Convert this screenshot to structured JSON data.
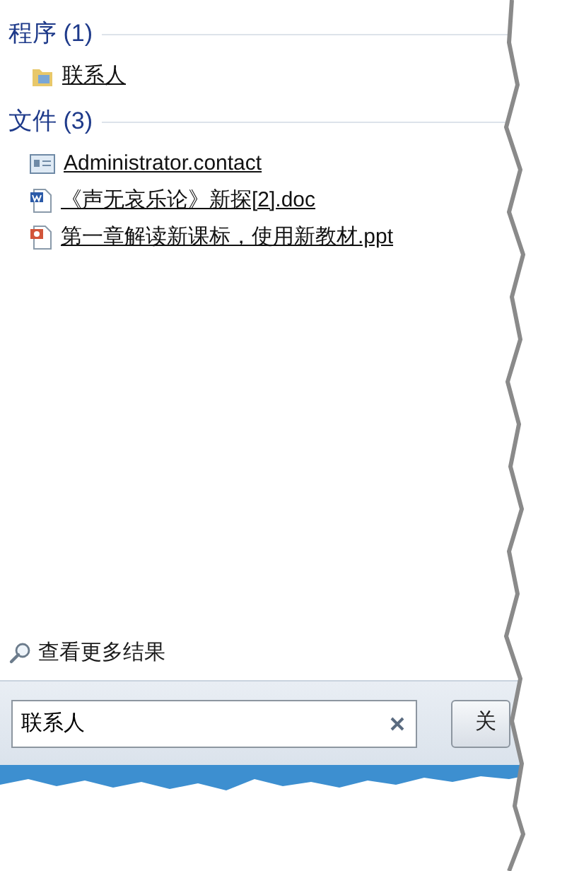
{
  "groups": [
    {
      "heading": "程序 (1)",
      "items": [
        {
          "kind": "folder",
          "label": "联系人"
        }
      ]
    },
    {
      "heading": "文件 (3)",
      "items": [
        {
          "kind": "contact",
          "label": "Administrator.contact"
        },
        {
          "kind": "word",
          "label": "《声无哀乐论》新探[2].doc"
        },
        {
          "kind": "powerpoint",
          "label": "第一章解读新课标，使用新教材.ppt"
        }
      ]
    }
  ],
  "more_results": "查看更多结果",
  "search": {
    "value": "联系人"
  },
  "shutdown_button": "关"
}
